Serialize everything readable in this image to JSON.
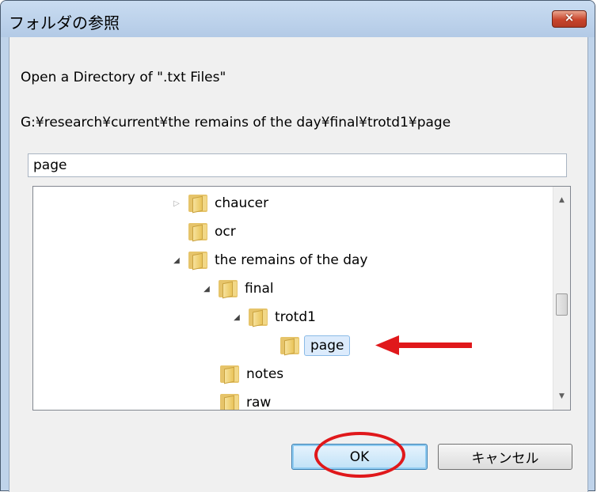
{
  "dialog": {
    "title": "フォルダの参照",
    "close_icon": "×",
    "description": "Open a Directory of \".txt Files\"",
    "path": "G:¥research¥current¥the remains of the day¥final¥trotd1¥page",
    "folder_name_value": "page"
  },
  "tree": {
    "items": [
      {
        "label": "chaucer",
        "expander": "collapsed"
      },
      {
        "label": "ocr",
        "expander": "none"
      },
      {
        "label": "the remains of the day",
        "expander": "expanded"
      },
      {
        "label": "final",
        "expander": "expanded"
      },
      {
        "label": "trotd1",
        "expander": "expanded"
      },
      {
        "label": "page",
        "expander": "none",
        "selected": true
      },
      {
        "label": "notes",
        "expander": "none"
      },
      {
        "label": "raw",
        "expander": "none"
      }
    ]
  },
  "buttons": {
    "ok_label": "OK",
    "cancel_label": "キャンセル"
  },
  "annotations": {
    "arrow_color": "#e0181b",
    "circle_color": "#e0181b"
  }
}
